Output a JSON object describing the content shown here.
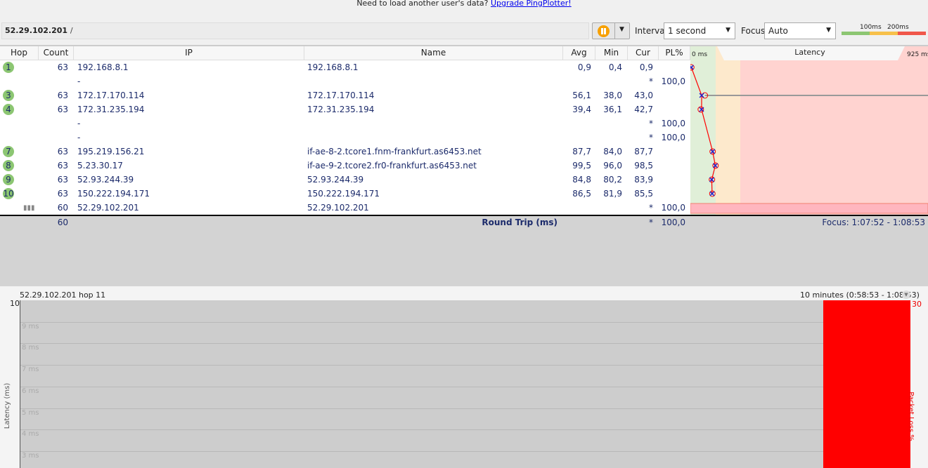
{
  "banner": {
    "text": "Need to load another user's data?",
    "link": "Upgrade PingPlotter!"
  },
  "toolbar": {
    "target": "52.29.102.201",
    "separator": "/",
    "interval_label": "Interval",
    "interval_value": "1 second",
    "focus_label": "Focus",
    "focus_value": "Auto",
    "legend": {
      "low": "100ms",
      "high": "200ms",
      "colors": [
        "#8cc672",
        "#f7c04a",
        "#f0574a"
      ]
    }
  },
  "table": {
    "headers": {
      "hop": "Hop",
      "count": "Count",
      "ip": "IP",
      "name": "Name",
      "avg": "Avg",
      "min": "Min",
      "cur": "Cur",
      "pl": "PL%",
      "latency": "Latency",
      "lat_min": "0 ms",
      "lat_max": "925 ms"
    },
    "rows": [
      {
        "hop": "1",
        "count": "63",
        "ip": "192.168.8.1",
        "name": "192.168.8.1",
        "avg": "0,9",
        "min": "0,4",
        "cur": "0,9",
        "pl": "",
        "avgv": 0.9,
        "curv": 0.9
      },
      {
        "hop": "",
        "count": "",
        "ip": "-",
        "name": "",
        "avg": "",
        "min": "",
        "cur": "*",
        "pl": "100,0"
      },
      {
        "hop": "3",
        "count": "63",
        "ip": "172.17.170.114",
        "name": "172.17.170.114",
        "avg": "56,1",
        "min": "38,0",
        "cur": "43,0",
        "pl": "",
        "avgv": 56.1,
        "curv": 43.0
      },
      {
        "hop": "4",
        "count": "63",
        "ip": "172.31.235.194",
        "name": "172.31.235.194",
        "avg": "39,4",
        "min": "36,1",
        "cur": "42,7",
        "pl": "",
        "avgv": 39.4,
        "curv": 42.7
      },
      {
        "hop": "",
        "count": "",
        "ip": "-",
        "name": "",
        "avg": "",
        "min": "",
        "cur": "*",
        "pl": "100,0"
      },
      {
        "hop": "",
        "count": "",
        "ip": "-",
        "name": "",
        "avg": "",
        "min": "",
        "cur": "*",
        "pl": "100,0"
      },
      {
        "hop": "7",
        "count": "63",
        "ip": "195.219.156.21",
        "name": "if-ae-8-2.tcore1.fnm-frankfurt.as6453.net",
        "avg": "87,7",
        "min": "84,0",
        "cur": "87,7",
        "pl": "",
        "avgv": 87.7,
        "curv": 87.7
      },
      {
        "hop": "8",
        "count": "63",
        "ip": "5.23.30.17",
        "name": "if-ae-9-2.tcore2.fr0-frankfurt.as6453.net",
        "avg": "99,5",
        "min": "96,0",
        "cur": "98,5",
        "pl": "",
        "avgv": 99.5,
        "curv": 98.5
      },
      {
        "hop": "9",
        "count": "63",
        "ip": "52.93.244.39",
        "name": "52.93.244.39",
        "avg": "84,8",
        "min": "80,2",
        "cur": "83,9",
        "pl": "",
        "avgv": 84.8,
        "curv": 83.9
      },
      {
        "hop": "10",
        "count": "63",
        "ip": "150.222.194.171",
        "name": "150.222.194.171",
        "avg": "86,5",
        "min": "81,9",
        "cur": "85,5",
        "pl": "",
        "avgv": 86.5,
        "curv": 85.5
      },
      {
        "hop": "",
        "count": "60",
        "ip": "52.29.102.201",
        "name": "52.29.102.201",
        "avg": "",
        "min": "",
        "cur": "*",
        "pl": "100,0",
        "final": true
      }
    ]
  },
  "summary": {
    "count": "60",
    "label": "Round Trip (ms)",
    "cur": "*",
    "pl": "100,0",
    "focus": "Focus: 1:07:52 - 1:08:53"
  },
  "lower": {
    "title": "52.29.102.201 hop 11",
    "range": "10 minutes (0:58:53 - 1:08:53)",
    "y_top": "10",
    "y_ticks": [
      "9 ms",
      "8 ms",
      "7 ms",
      "6 ms",
      "5 ms",
      "4 ms",
      "3 ms"
    ],
    "y_label": "Latency (ms)",
    "right_top": "30",
    "right_label": "Packet Loss %"
  }
}
